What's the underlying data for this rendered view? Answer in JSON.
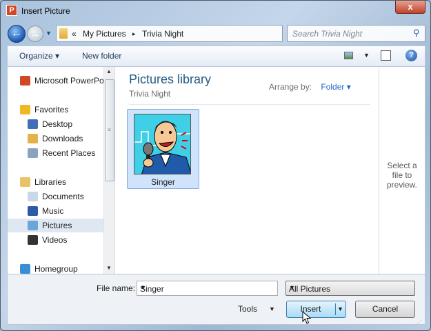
{
  "window": {
    "title": "Insert Picture",
    "close_label": "x"
  },
  "address": {
    "overflow": "«",
    "crumbs": [
      "My Pictures",
      "Trivia Night"
    ],
    "separator": "▸"
  },
  "search": {
    "placeholder": "Search Trivia Night"
  },
  "toolbar": {
    "organize": "Organize",
    "new_folder": "New folder"
  },
  "nav": {
    "items": [
      {
        "label": "Microsoft PowerPoint",
        "icon": "powerpoint-icon",
        "header": true
      },
      {
        "label": "Favorites",
        "icon": "star-icon",
        "header": true
      },
      {
        "label": "Desktop",
        "icon": "desktop-icon"
      },
      {
        "label": "Downloads",
        "icon": "downloads-folder-icon"
      },
      {
        "label": "Recent Places",
        "icon": "recent-places-icon"
      },
      {
        "label": "Libraries",
        "icon": "libraries-icon",
        "header": true
      },
      {
        "label": "Documents",
        "icon": "documents-icon"
      },
      {
        "label": "Music",
        "icon": "music-icon"
      },
      {
        "label": "Pictures",
        "icon": "pictures-icon",
        "selected": true
      },
      {
        "label": "Videos",
        "icon": "videos-icon"
      },
      {
        "label": "Homegroup",
        "icon": "homegroup-icon",
        "header": true
      }
    ]
  },
  "content": {
    "title": "Pictures library",
    "subtitle": "Trivia Night",
    "arrange_label": "Arrange by:",
    "arrange_value": "Folder",
    "files": [
      {
        "name": "Singer"
      }
    ]
  },
  "preview": {
    "text": "Select a file to preview."
  },
  "bottom": {
    "file_name_label": "File name:",
    "file_name_value": "Singer",
    "filter_value": "All Pictures",
    "tools": "Tools",
    "insert": "Insert",
    "cancel": "Cancel"
  },
  "colors": {
    "accent": "#1e64c8",
    "selection": "#cfe3fb",
    "close": "#c0432b"
  }
}
